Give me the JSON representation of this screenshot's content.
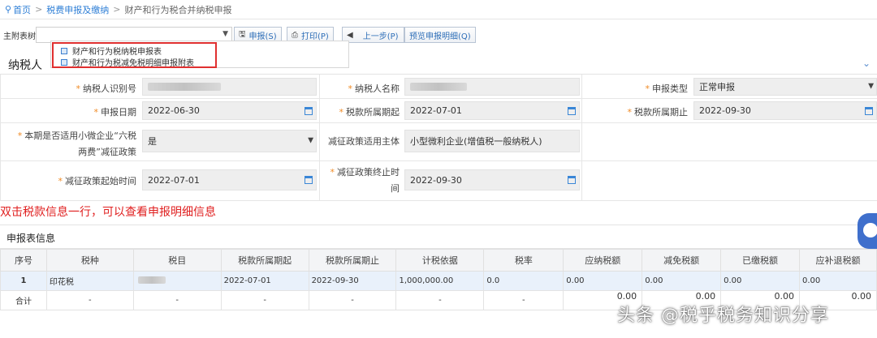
{
  "breadcrumb": {
    "home": "首页",
    "section": "税费申报及缴纳",
    "current": "财产和行为税合并纳税申报"
  },
  "toolbar": {
    "table_label": "主附表树:",
    "declare": "申报(S)",
    "print": "打印(P)",
    "prev": "上一步(P)",
    "preview": "预览申报明细(Q)"
  },
  "dropdown": {
    "items": [
      "财产和行为税纳税申报表",
      "财产和行为税减免税明细申报附表"
    ]
  },
  "taxpayer_section": {
    "title": "纳税人"
  },
  "form": {
    "taxpayer_id_label": "纳税人识别号",
    "taxpayer_name_label": "纳税人名称",
    "declare_type_label": "申报类型",
    "declare_type_value": "正常申报",
    "declare_date_label": "申报日期",
    "declare_date_value": "2022-06-30",
    "period_start_label": "税款所属期起",
    "period_start_value": "2022-07-01",
    "period_end_label": "税款所属期止",
    "period_end_value": "2022-09-30",
    "small_biz_label_1": "本期是否适用小微企业“六税",
    "small_biz_label_2": "两费”减征政策",
    "small_biz_value": "是",
    "policy_subject_label": "减征政策适用主体",
    "policy_subject_value": "小型微利企业(增值税一般纳税人)",
    "policy_start_label": "减征政策起始时间",
    "policy_start_value": "2022-07-01",
    "policy_end_label_1": "减征政策终止时",
    "policy_end_label_2": "间",
    "policy_end_value": "2022-09-30"
  },
  "hint": "双击税款信息一行，可以查看申报明细信息",
  "table": {
    "title": "申报表信息",
    "headers": [
      "序号",
      "税种",
      "税目",
      "税款所属期起",
      "税款所属期止",
      "计税依据",
      "税率",
      "应纳税额",
      "减免税额",
      "已缴税额",
      "应补退税额"
    ],
    "row": [
      "1",
      "印花税",
      "",
      "2022-07-01",
      "2022-09-30",
      "1,000,000.00",
      "0.0",
      "0.00",
      "0.00",
      "0.00",
      "0.00"
    ],
    "total": [
      "合计",
      "-",
      "-",
      "-",
      "-",
      "-",
      "-",
      "0.00",
      "0.00",
      "0.00",
      "0.00"
    ]
  },
  "watermark": "头条 @税乎税务知识分享",
  "colors": {
    "link": "#2f7fd6",
    "required_star": "#f08a24",
    "hint_red": "#e02020",
    "highlight_box": "#e03030",
    "selected_row": "#e9f1fb"
  }
}
